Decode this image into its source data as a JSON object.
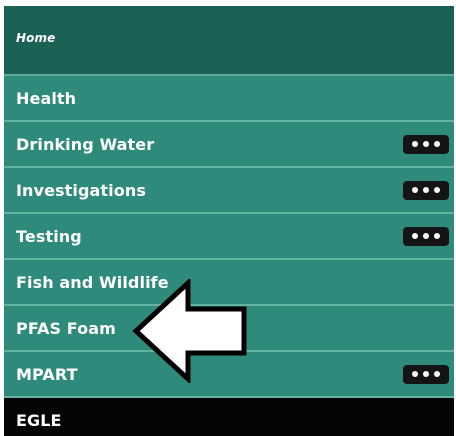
{
  "menu": {
    "home_label": "Home",
    "items": [
      {
        "label": "Health",
        "has_more": false
      },
      {
        "label": "Drinking Water",
        "has_more": true
      },
      {
        "label": "Investigations",
        "has_more": true
      },
      {
        "label": "Testing",
        "has_more": true
      },
      {
        "label": "Fish and Wildlife",
        "has_more": false
      },
      {
        "label": "PFAS Foam",
        "has_more": false
      },
      {
        "label": "MPART",
        "has_more": true
      },
      {
        "label": "EGLE",
        "has_more": false
      }
    ]
  },
  "colors": {
    "menu_background": "#2e8b7b",
    "home_background": "#1b6156",
    "separator": "#63b3a3",
    "egle_background": "#050505",
    "more_button_background": "#141414",
    "arrow_fill": "#ffffff",
    "arrow_outline": "#000000"
  },
  "icons": {
    "more": "more-dots-icon",
    "pointer": "left-arrow-icon"
  }
}
